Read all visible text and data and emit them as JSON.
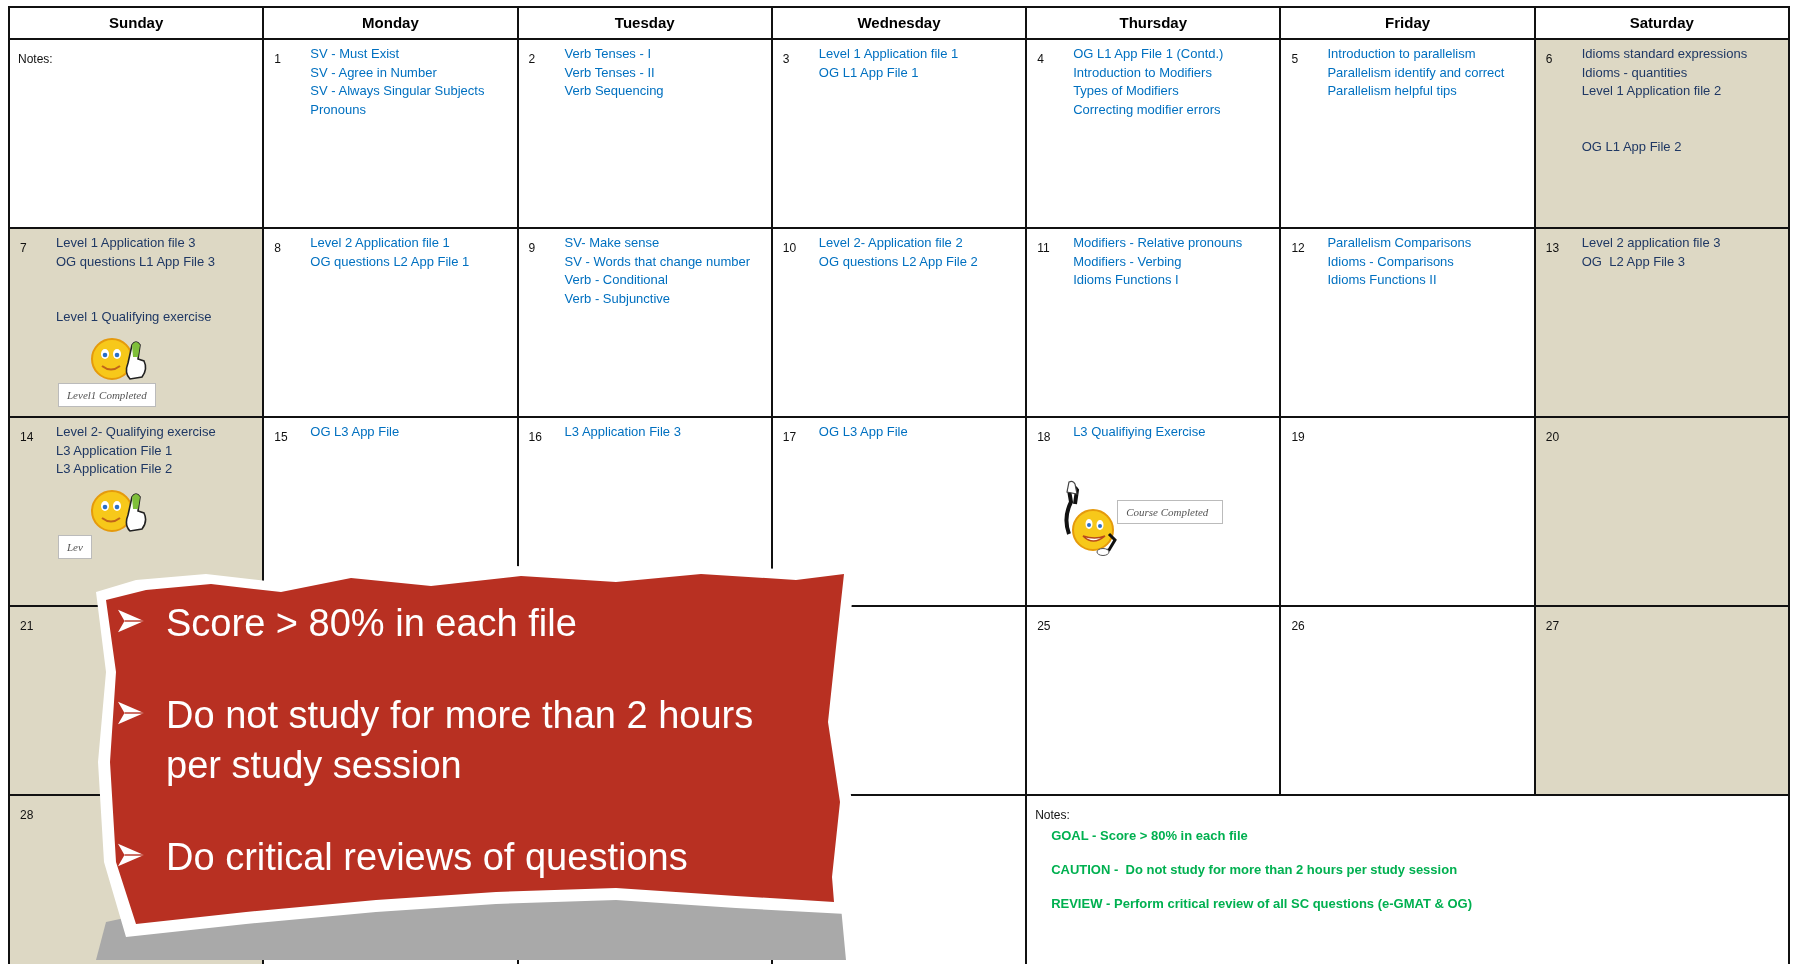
{
  "calendar": {
    "days": [
      "Sunday",
      "Monday",
      "Tuesday",
      "Wednesday",
      "Thursday",
      "Friday",
      "Saturday"
    ],
    "weeks": [
      {
        "cells": [
          {
            "kind": "notes",
            "weekend": false,
            "label": "Notes:"
          },
          {
            "kind": "day",
            "weekend": false,
            "day": "1",
            "items": [
              "SV - Must Exist",
              "SV - Agree in Number",
              "SV - Always Singular Subjects",
              "Pronouns"
            ]
          },
          {
            "kind": "day",
            "weekend": false,
            "day": "2",
            "items": [
              "Verb Tenses - I",
              "Verb Tenses - II",
              "Verb Sequencing"
            ]
          },
          {
            "kind": "day",
            "weekend": false,
            "day": "3",
            "items": [
              "Level 1 Application file 1",
              "OG L1 App File 1"
            ]
          },
          {
            "kind": "day",
            "weekend": false,
            "day": "4",
            "items": [
              "OG L1 App File 1 (Contd.)",
              "Introduction to Modifiers",
              "Types of Modifiers",
              "Correcting modifier errors"
            ]
          },
          {
            "kind": "day",
            "weekend": false,
            "day": "5",
            "items": [
              "Introduction to parallelism",
              "Parallelism identify and correct",
              "Parallelism helpful tips"
            ]
          },
          {
            "kind": "day",
            "weekend": true,
            "day": "6",
            "groups": [
              [
                "Idioms standard expressions",
                "Idioms - quantities",
                "Level 1 Application file 2"
              ],
              [
                "OG L1 App File 2"
              ]
            ]
          }
        ]
      },
      {
        "cells": [
          {
            "kind": "day",
            "weekend": true,
            "day": "7",
            "groups": [
              [
                "Level 1 Application file 3",
                "OG questions L1 App File 3"
              ],
              [
                "Level 1 Qualifying exercise"
              ]
            ],
            "sticker": {
              "kind": "thumbs_up",
              "label": "Level1 Completed"
            }
          },
          {
            "kind": "day",
            "weekend": false,
            "day": "8",
            "items": [
              "Level 2 Application file 1",
              "OG questions L2 App File 1"
            ]
          },
          {
            "kind": "day",
            "weekend": false,
            "day": "9",
            "items": [
              "SV- Make sense",
              "SV - Words that change number",
              "Verb - Conditional",
              "Verb - Subjunctive"
            ]
          },
          {
            "kind": "day",
            "weekend": false,
            "day": "10",
            "items": [
              "Level 2- Application file 2",
              "OG questions L2 App File 2"
            ]
          },
          {
            "kind": "day",
            "weekend": false,
            "day": "11",
            "items": [
              "Modifiers - Relative pronouns",
              "Modifiers - Verbing",
              "Idioms Functions I"
            ]
          },
          {
            "kind": "day",
            "weekend": false,
            "day": "12",
            "items": [
              "Parallelism Comparisons",
              "Idioms - Comparisons",
              "Idioms Functions II"
            ]
          },
          {
            "kind": "day",
            "weekend": true,
            "day": "13",
            "items": [
              "Level 2 application file 3",
              "OG  L2 App File 3"
            ]
          }
        ]
      },
      {
        "cells": [
          {
            "kind": "day",
            "weekend": true,
            "day": "14",
            "items": [
              "Level 2- Qualifying exercise",
              "L3 Application File 1",
              "L3 Application File 2"
            ],
            "sticker": {
              "kind": "thumbs_up",
              "label": "Lev"
            }
          },
          {
            "kind": "day",
            "weekend": false,
            "day": "15",
            "items": [
              "OG L3 App File"
            ]
          },
          {
            "kind": "day",
            "weekend": false,
            "day": "16",
            "items": [
              "L3 Application File 3"
            ]
          },
          {
            "kind": "day",
            "weekend": false,
            "day": "17",
            "items": [
              "OG L3 App File"
            ]
          },
          {
            "kind": "day",
            "weekend": false,
            "day": "18",
            "items": [
              "L3 Qualifiying Exercise"
            ],
            "sticker": {
              "kind": "pointing",
              "label": "Course Completed"
            }
          },
          {
            "kind": "day",
            "weekend": false,
            "day": "19"
          },
          {
            "kind": "day",
            "weekend": true,
            "day": "20"
          }
        ]
      },
      {
        "cells": [
          {
            "kind": "day",
            "weekend": true,
            "day": "21"
          },
          {
            "kind": "day"
          },
          {
            "kind": "day"
          },
          {
            "kind": "day",
            "weekend": false
          },
          {
            "kind": "day",
            "weekend": false,
            "day": "25"
          },
          {
            "kind": "day",
            "weekend": false,
            "day": "26"
          },
          {
            "kind": "day",
            "weekend": true,
            "day": "27"
          }
        ]
      },
      {
        "cells": [
          {
            "kind": "day",
            "weekend": true,
            "day": "28"
          },
          {
            "kind": "day"
          },
          {
            "kind": "day"
          },
          {
            "kind": "day",
            "weekend": false
          },
          {
            "kind": "notes",
            "weekend": false,
            "wide": true,
            "label": "Notes:",
            "items": [
              "GOAL - Score > 80% in each file",
              "CAUTION -  Do not study for more than 2 hours per study session",
              "REVIEW - Perform critical review of all SC questions (e-GMAT & OG)"
            ]
          }
        ]
      }
    ]
  },
  "callout": {
    "bullets": [
      "Score > 80% in each file",
      "Do not study for more than 2 hours per study session",
      "Do critical reviews of questions"
    ]
  }
}
